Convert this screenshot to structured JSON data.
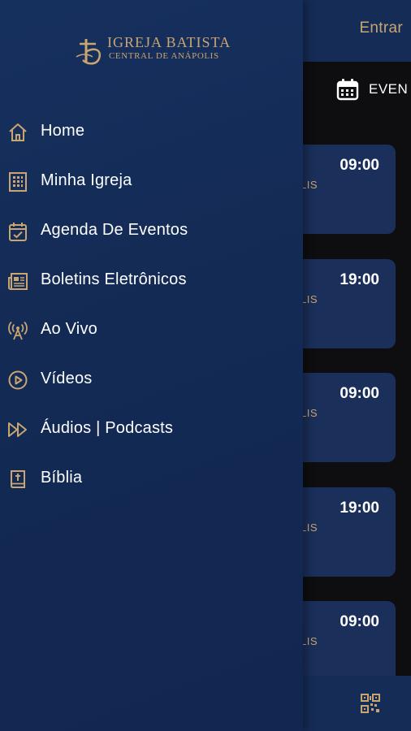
{
  "header": {
    "login_label": "Entrar"
  },
  "tabs": {
    "events_label": "EVEN"
  },
  "cards": [
    {
      "time": "09:00",
      "city_fragment": "LIS"
    },
    {
      "time": "19:00",
      "city_fragment": "LIS"
    },
    {
      "time": "09:00",
      "city_fragment": "LIS"
    },
    {
      "time": "19:00",
      "city_fragment": "LIS"
    },
    {
      "time": "09:00",
      "city_fragment": "LIS"
    }
  ],
  "drawer": {
    "logo": {
      "line1": "IGREJA BATISTA",
      "line2": "CENTRAL DE ANÁPOLIS"
    },
    "items": [
      {
        "label": "Home",
        "icon": "home-icon"
      },
      {
        "label": "Minha Igreja",
        "icon": "building-icon"
      },
      {
        "label": "Agenda De Eventos",
        "icon": "calendar-check-icon"
      },
      {
        "label": "Boletins Eletrônicos",
        "icon": "newspaper-icon"
      },
      {
        "label": "Ao Vivo",
        "icon": "broadcast-icon"
      },
      {
        "label": "Vídeos",
        "icon": "play-circle-icon"
      },
      {
        "label": "Áudios | Podcasts",
        "icon": "fast-forward-icon"
      },
      {
        "label": "Bíblia",
        "icon": "bible-icon"
      }
    ]
  },
  "colors": {
    "gold": "#c9a572",
    "navy": "#152c57",
    "card": "#1a2f5a",
    "background": "#0e0e10"
  }
}
